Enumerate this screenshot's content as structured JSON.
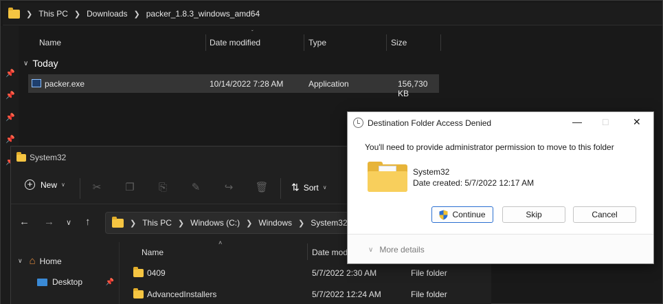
{
  "back_window": {
    "breadcrumb": [
      "This PC",
      "Downloads",
      "packer_1.8.3_windows_amd64"
    ],
    "columns": [
      "Name",
      "Date modified",
      "Type",
      "Size"
    ],
    "group": "Today",
    "rows": [
      {
        "name": "packer.exe",
        "date": "10/14/2022 7:28 AM",
        "type": "Application",
        "size": "156,730 KB"
      }
    ]
  },
  "mid_window": {
    "title": "System32",
    "toolbar": {
      "new_label": "New",
      "sort_label": "Sort"
    },
    "breadcrumb": [
      "This PC",
      "Windows (C:)",
      "Windows",
      "System32"
    ],
    "sidebar": [
      {
        "label": "Home",
        "icon": "home-icon"
      },
      {
        "label": "Desktop",
        "icon": "desktop-icon"
      }
    ],
    "columns": [
      "Name",
      "Date mod"
    ],
    "rows": [
      {
        "name": "0409",
        "date": "5/7/2022 2:30 AM",
        "type": "File folder"
      },
      {
        "name": "AdvancedInstallers",
        "date": "5/7/2022 12:24 AM",
        "type": "File folder"
      }
    ]
  },
  "dialog": {
    "title": "Destination Folder Access Denied",
    "message": "You'll need to provide administrator permission to move to this folder",
    "folder_name": "System32",
    "folder_date": "Date created: 5/7/2022 12:17 AM",
    "buttons": {
      "continue": "Continue",
      "skip": "Skip",
      "cancel": "Cancel"
    },
    "more_details": "More details",
    "colors": {
      "accent": "#2a6fd1",
      "folder": "#f8cf5c"
    }
  }
}
